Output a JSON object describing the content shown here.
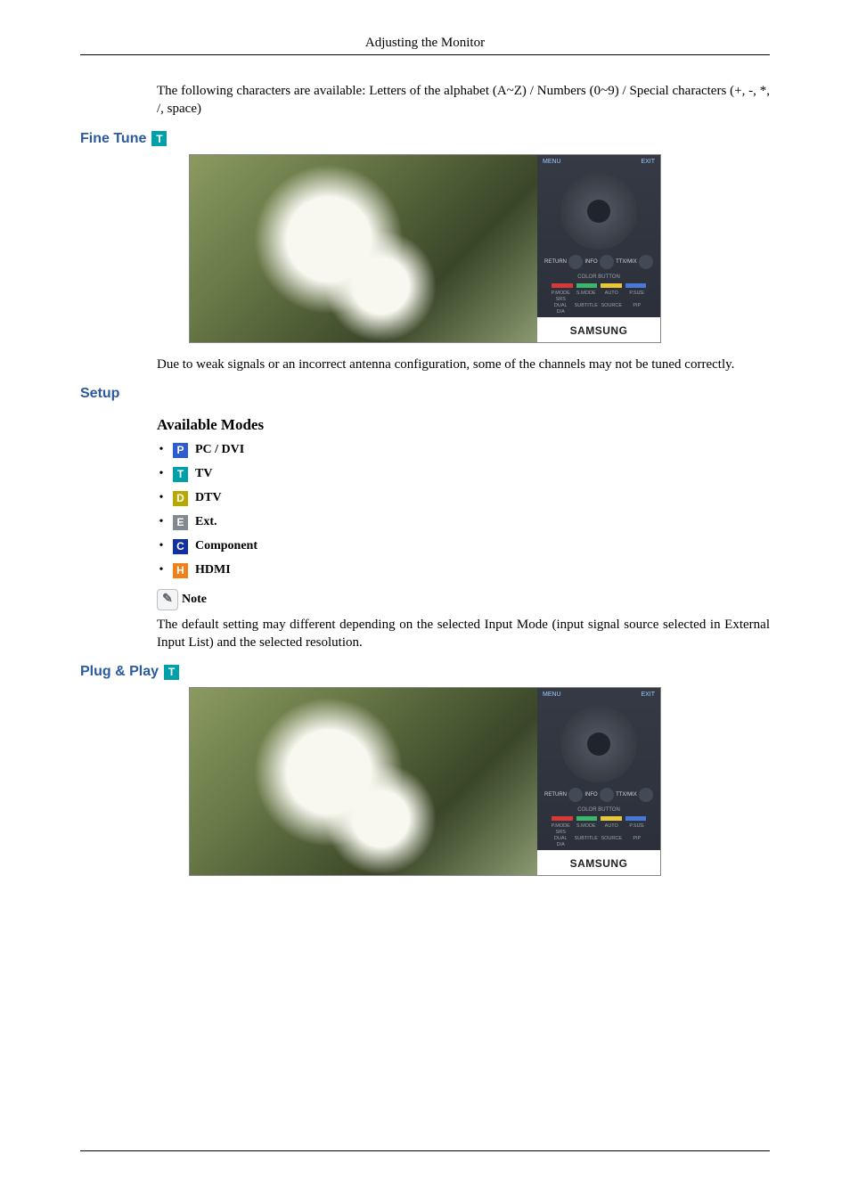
{
  "header": {
    "title": "Adjusting the Monitor"
  },
  "intro": {
    "chars_text": "The following characters are available: Letters of the alphabet (A~Z) / Numbers (0~9) / Special characters (+, -, *, /, space)"
  },
  "sections": {
    "fine_tune": {
      "heading": "Fine Tune",
      "badge_letter": "T",
      "description": "Due to weak signals or an incorrect antenna configuration, some of the channels may not be tuned correctly."
    },
    "setup": {
      "heading": "Setup",
      "available_heading": "Available Modes",
      "modes": [
        {
          "letter": "P",
          "color": "b-blue",
          "label": "PC / DVI"
        },
        {
          "letter": "T",
          "color": "b-teal",
          "label": "TV"
        },
        {
          "letter": "D",
          "color": "b-olive",
          "label": "DTV"
        },
        {
          "letter": "E",
          "color": "b-gray",
          "label": "Ext."
        },
        {
          "letter": "C",
          "color": "b-navy",
          "label": "Component"
        },
        {
          "letter": "H",
          "color": "b-orange",
          "label": "HDMI"
        }
      ],
      "note_label": "Note",
      "note_icon": "✎",
      "note_text": "The default setting may different depending on the selected Input Mode (input signal source selected in External Input List) and the selected resolution."
    },
    "plug_play": {
      "heading": "Plug & Play",
      "badge_letter": "T"
    }
  },
  "remote": {
    "top_left": "MENU",
    "top_right": "EXIT",
    "mid_left": "RETURN",
    "mid_center": "INFO",
    "mid_right": "TTX/MIX",
    "color_label": "COLOR BUTTON",
    "grid": [
      "P.MODE",
      "S.MODE",
      "AUTO",
      "P.SIZE",
      "SRS",
      "",
      "",
      "",
      "DUAL",
      "SUBTITLE",
      "SOURCE",
      "PIP",
      "D/A",
      "",
      "",
      ""
    ],
    "logo": "SAMSUNG"
  }
}
